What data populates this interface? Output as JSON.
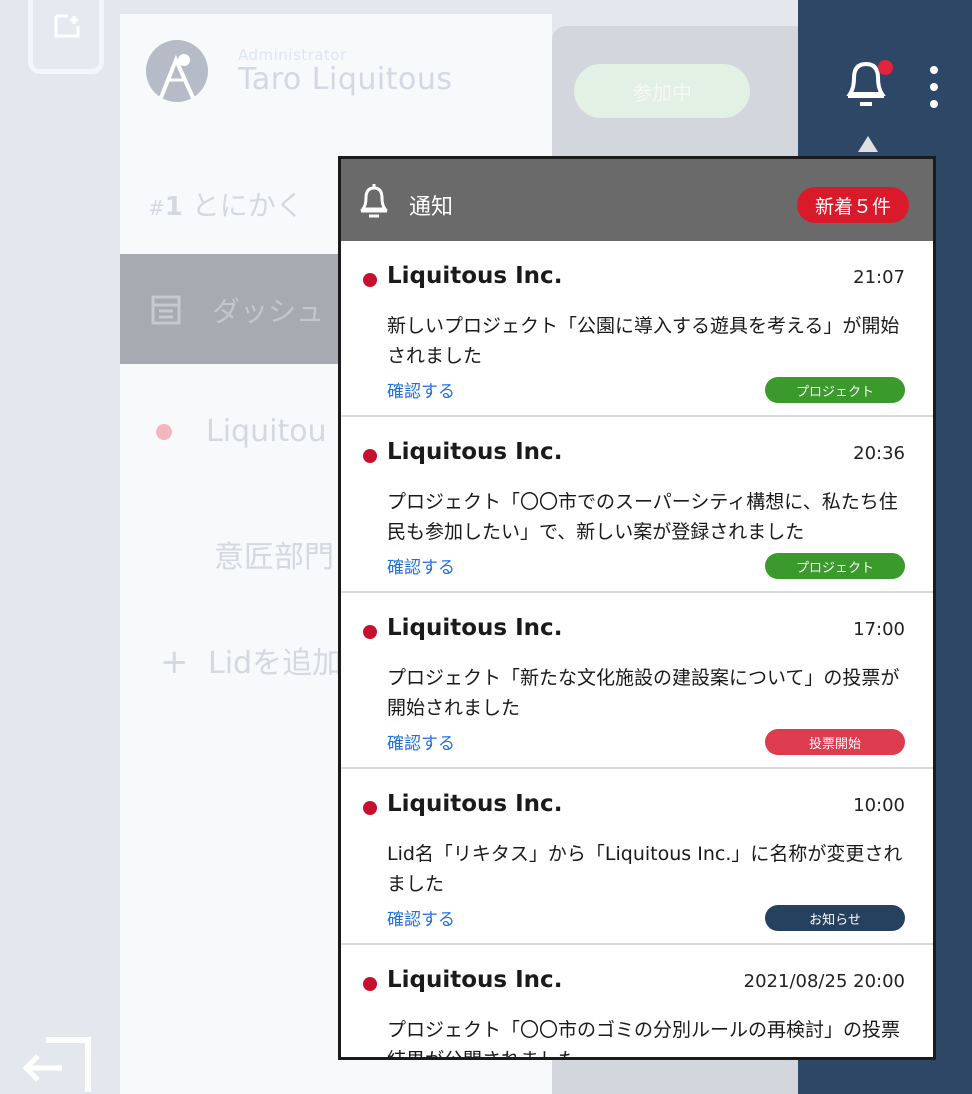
{
  "colors": {
    "rail_bg": "#e4e8ee",
    "topbar_bg": "#2f4766",
    "popup_header_bg": "#6a6a6a",
    "new_badge_bg": "#d91a2a",
    "unread_dot": "#c8102e",
    "link": "#1e6fd9"
  },
  "sidebar": {
    "profile": {
      "role": "Administrator",
      "name": "Taro Liquitous"
    },
    "project": {
      "number_prefix": "#",
      "number": "1",
      "name": "とにかく"
    },
    "dashboard": {
      "icon": "dashboard-icon",
      "label": "ダッシュ"
    },
    "lid": {
      "label": "Liquitou"
    },
    "department": {
      "label": "意匠部門"
    },
    "add_lid": {
      "plus": "+",
      "label": "Lidを追加"
    }
  },
  "main": {
    "joined_label": "参加中"
  },
  "topbar": {
    "bell_icon": "bell-icon",
    "more_icon": "more-vertical-icon"
  },
  "notifications": {
    "title": "通知",
    "new_badge": "新着５件",
    "items": [
      {
        "sender": "Liquitous Inc.",
        "time": "21:07",
        "message": "新しいプロジェクト「公園に導入する遊具を考える」が開始されました",
        "link": "確認する",
        "tag": "プロジェクト",
        "tag_color": "#3a9a2c"
      },
      {
        "sender": "Liquitous Inc.",
        "time": "20:36",
        "message": "プロジェクト「〇〇市でのスーパーシティ構想に、私たち住民も参加したい」で、新しい案が登録されました",
        "link": "確認する",
        "tag": "プロジェクト",
        "tag_color": "#3a9a2c"
      },
      {
        "sender": "Liquitous Inc.",
        "time": "17:00",
        "message": "プロジェクト「新たな文化施設の建設案について」の投票が開始されました",
        "link": "確認する",
        "tag": "投票開始",
        "tag_color": "#dd3b4e"
      },
      {
        "sender": "Liquitous Inc.",
        "time": "10:00",
        "message": "Lid名「リキタス」から「Liquitous Inc.」に名称が変更されました",
        "link": "確認する",
        "tag": "お知らせ",
        "tag_color": "#26415f"
      },
      {
        "sender": "Liquitous Inc.",
        "time": "2021/08/25 20:00",
        "message": "プロジェクト「〇〇市のゴミの分別ルールの再検討」の投票結果が公開されました",
        "link": "",
        "tag": "",
        "tag_color": "#26415f"
      }
    ]
  }
}
